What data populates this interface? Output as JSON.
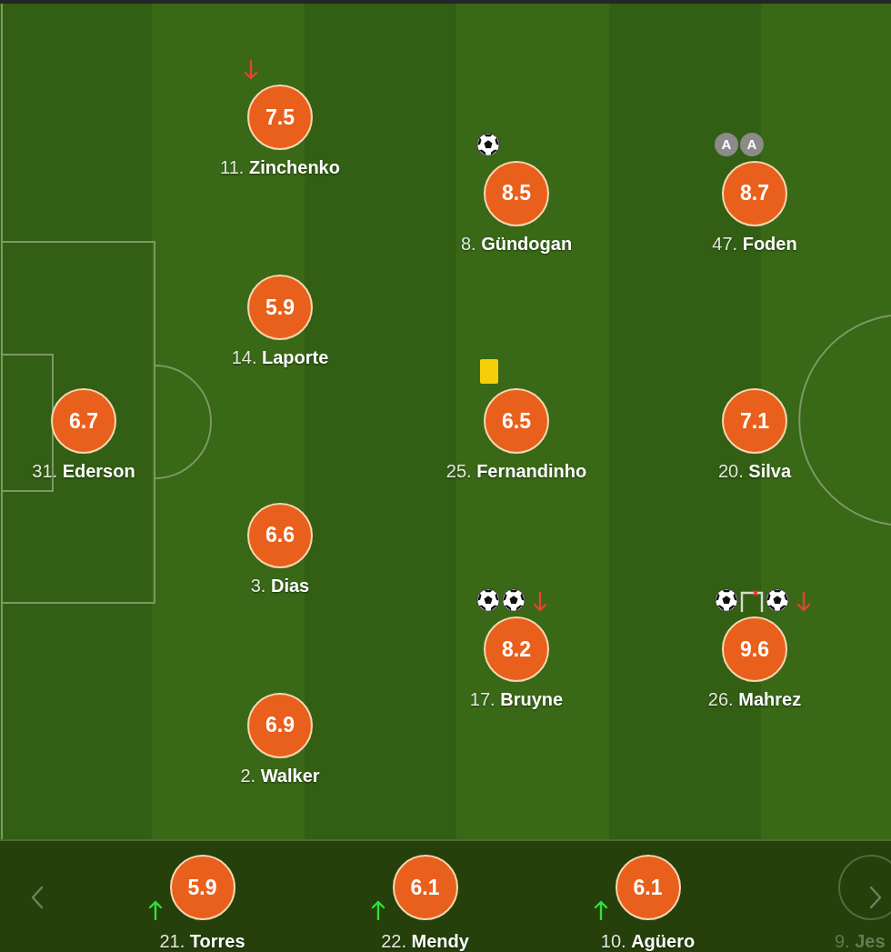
{
  "pitch": {
    "lines": [
      {
        "players": [
          {
            "label": "31. **Ederson**",
            "rating": "6.7"
          }
        ]
      },
      {
        "players": [
          {
            "label": "11. **Zinchenko**",
            "rating": "7.5",
            "events": [
              {
                "kind": "sub_off"
              }
            ]
          },
          {
            "label": "14. **Laporte**",
            "rating": "5.9"
          },
          {
            "label": "3. **Dias**",
            "rating": "6.6"
          },
          {
            "label": "2. **Walker**",
            "rating": "6.9"
          }
        ]
      },
      {
        "players": [
          {
            "label": "8. **Gündogan**",
            "rating": "8.5",
            "events": [
              {
                "kind": "goal"
              }
            ]
          },
          {
            "label": "25. **Fernandinho**",
            "rating": "6.5",
            "events": [
              {
                "kind": "yellow_card"
              }
            ]
          },
          {
            "label": "17. **Bruyne**",
            "rating": "8.2",
            "events": [
              {
                "kind": "goal"
              },
              {
                "kind": "goal"
              },
              {
                "kind": "sub_off"
              }
            ]
          }
        ]
      },
      {
        "players": [
          {
            "label": "47. **Foden**",
            "rating": "8.7",
            "events": [
              {
                "kind": "assist",
                "label": "A"
              },
              {
                "kind": "assist",
                "label": "A"
              }
            ]
          },
          {
            "label": "20. **Silva**",
            "rating": "7.1"
          },
          {
            "label": "26. **Mahrez**",
            "rating": "9.6",
            "events": [
              {
                "kind": "goal"
              },
              {
                "kind": "woodwork"
              },
              {
                "kind": "goal"
              },
              {
                "kind": "sub_off"
              }
            ]
          }
        ]
      }
    ]
  },
  "bench": {
    "players": [
      {
        "label": "21. **Torres**",
        "rating": "5.9",
        "events": [
          {
            "kind": "sub_on"
          }
        ],
        "dimmed": false
      },
      {
        "label": "22. **Mendy**",
        "rating": "6.1",
        "events": [
          {
            "kind": "sub_on"
          }
        ],
        "dimmed": false
      },
      {
        "label": "10. **Agüero**",
        "rating": "6.1",
        "events": [
          {
            "kind": "sub_on"
          }
        ],
        "dimmed": false
      },
      {
        "label": "9. **Jes**",
        "dimmed": true
      }
    ]
  }
}
